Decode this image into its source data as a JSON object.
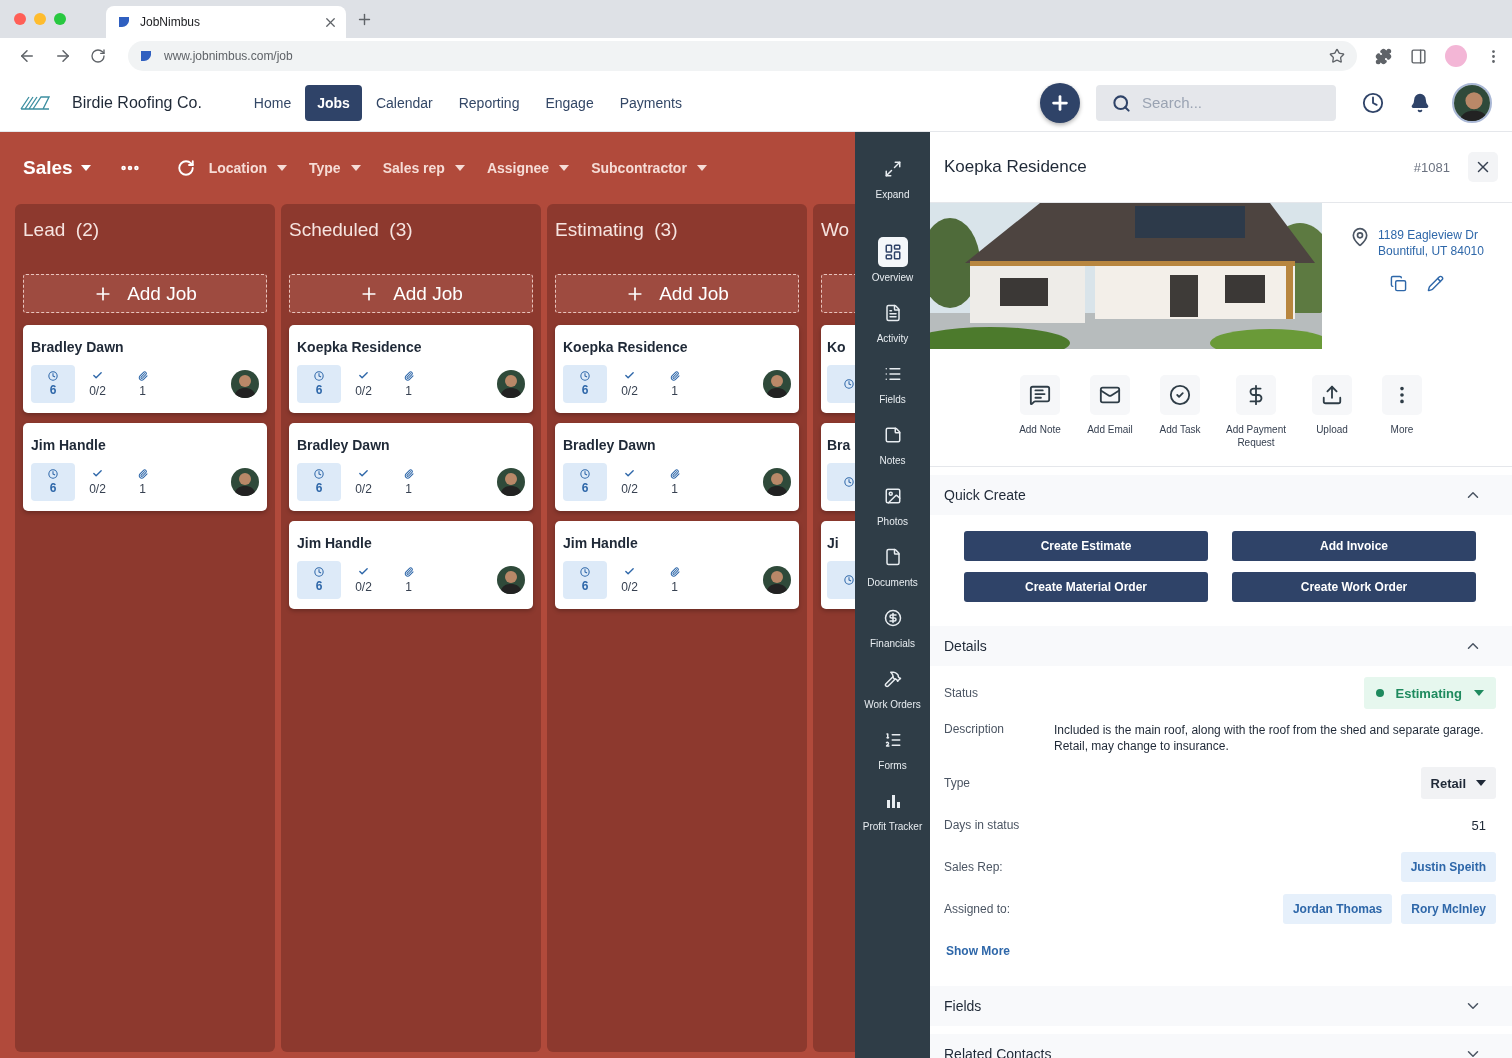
{
  "browser": {
    "tab_title": "JobNimbus",
    "url": "www.jobnimbus.com/job"
  },
  "app": {
    "company": "Birdie Roofing Co.",
    "nav": [
      {
        "label": "Home",
        "selected": false
      },
      {
        "label": "Jobs",
        "selected": true
      },
      {
        "label": "Calendar",
        "selected": false
      },
      {
        "label": "Reporting",
        "selected": false
      },
      {
        "label": "Engage",
        "selected": false
      },
      {
        "label": "Payments",
        "selected": false
      }
    ],
    "search": {
      "placeholder": "Search..."
    }
  },
  "board": {
    "view": "Sales",
    "filters": [
      "Location",
      "Type",
      "Sales rep",
      "Assignee",
      "Subcontractor"
    ],
    "columns": [
      {
        "kind": "full",
        "title": "Lead",
        "count": "(2)",
        "add_label": "Add Job",
        "cards": [
          {
            "name": "Bradley Dawn",
            "time": "6",
            "tasks": "0/2",
            "attachments": "1"
          },
          {
            "name": "Jim Handle",
            "time": "6",
            "tasks": "0/2",
            "attachments": "1"
          }
        ]
      },
      {
        "kind": "full",
        "title": "Scheduled",
        "count": "(3)",
        "add_label": "Add Job",
        "cards": [
          {
            "name": "Koepka Residence",
            "time": "6",
            "tasks": "0/2",
            "attachments": "1"
          },
          {
            "name": "Bradley Dawn",
            "time": "6",
            "tasks": "0/2",
            "attachments": "1"
          },
          {
            "name": "Jim Handle",
            "time": "6",
            "tasks": "0/2",
            "attachments": "1"
          }
        ]
      },
      {
        "kind": "full",
        "title": "Estimating",
        "count": "(3)",
        "add_label": "Add Job",
        "cards": [
          {
            "name": "Koepka Residence",
            "time": "6",
            "tasks": "0/2",
            "attachments": "1"
          },
          {
            "name": "Bradley Dawn",
            "time": "6",
            "tasks": "0/2",
            "attachments": "1"
          },
          {
            "name": "Jim Handle",
            "time": "6",
            "tasks": "0/2",
            "attachments": "1"
          }
        ]
      },
      {
        "kind": "partial",
        "title": "Wo",
        "cards": [
          {
            "name": "Ko"
          },
          {
            "name": "Bra"
          },
          {
            "name": "Ji"
          }
        ]
      }
    ]
  },
  "rail": [
    {
      "label": "Expand",
      "selected": false
    },
    {
      "label": "Overview",
      "selected": true
    },
    {
      "label": "Activity",
      "selected": false
    },
    {
      "label": "Fields",
      "selected": false
    },
    {
      "label": "Notes",
      "selected": false
    },
    {
      "label": "Photos",
      "selected": false
    },
    {
      "label": "Documents",
      "selected": false
    },
    {
      "label": "Financials",
      "selected": false
    },
    {
      "label": "Work Orders",
      "selected": false
    },
    {
      "label": "Forms",
      "selected": false
    },
    {
      "label": "Profit Tracker",
      "selected": false
    }
  ],
  "job": {
    "title": "Koepka Residence",
    "number": "#1081",
    "address": [
      "1189 Eagleview Dr",
      "Bountiful, UT 84010"
    ],
    "actions": [
      "Add Note",
      "Add Email",
      "Add Task",
      "Add Payment Request",
      "Upload",
      "More"
    ],
    "sections": [
      {
        "kind": "buttons",
        "title": "Quick Create",
        "expanded": true,
        "buttons": [
          "Create Estimate",
          "Add Invoice",
          "Create Material Order",
          "Create Work Order"
        ]
      },
      {
        "kind": "details",
        "title": "Details",
        "expanded": true,
        "rows": [
          {
            "kind": "status",
            "label": "Status",
            "value": "Estimating",
            "color": "#1e8a5e"
          },
          {
            "kind": "text",
            "label": "Description",
            "value": "Included is the main roof, along with the roof from the shed and separate garage. Retail, may change to insurance."
          },
          {
            "kind": "select",
            "label": "Type",
            "value": "Retail"
          },
          {
            "kind": "number",
            "label": "Days in status",
            "value": "51"
          },
          {
            "kind": "chips",
            "label": "Sales Rep:",
            "chips": [
              "Justin Speith"
            ]
          },
          {
            "kind": "chips",
            "label": "Assigned to:",
            "chips": [
              "Jordan Thomas",
              "Rory McInley"
            ]
          }
        ],
        "show_more": "Show More"
      },
      {
        "title": "Fields",
        "expanded": false
      },
      {
        "title": "Related Contacts",
        "expanded": false
      }
    ]
  }
}
